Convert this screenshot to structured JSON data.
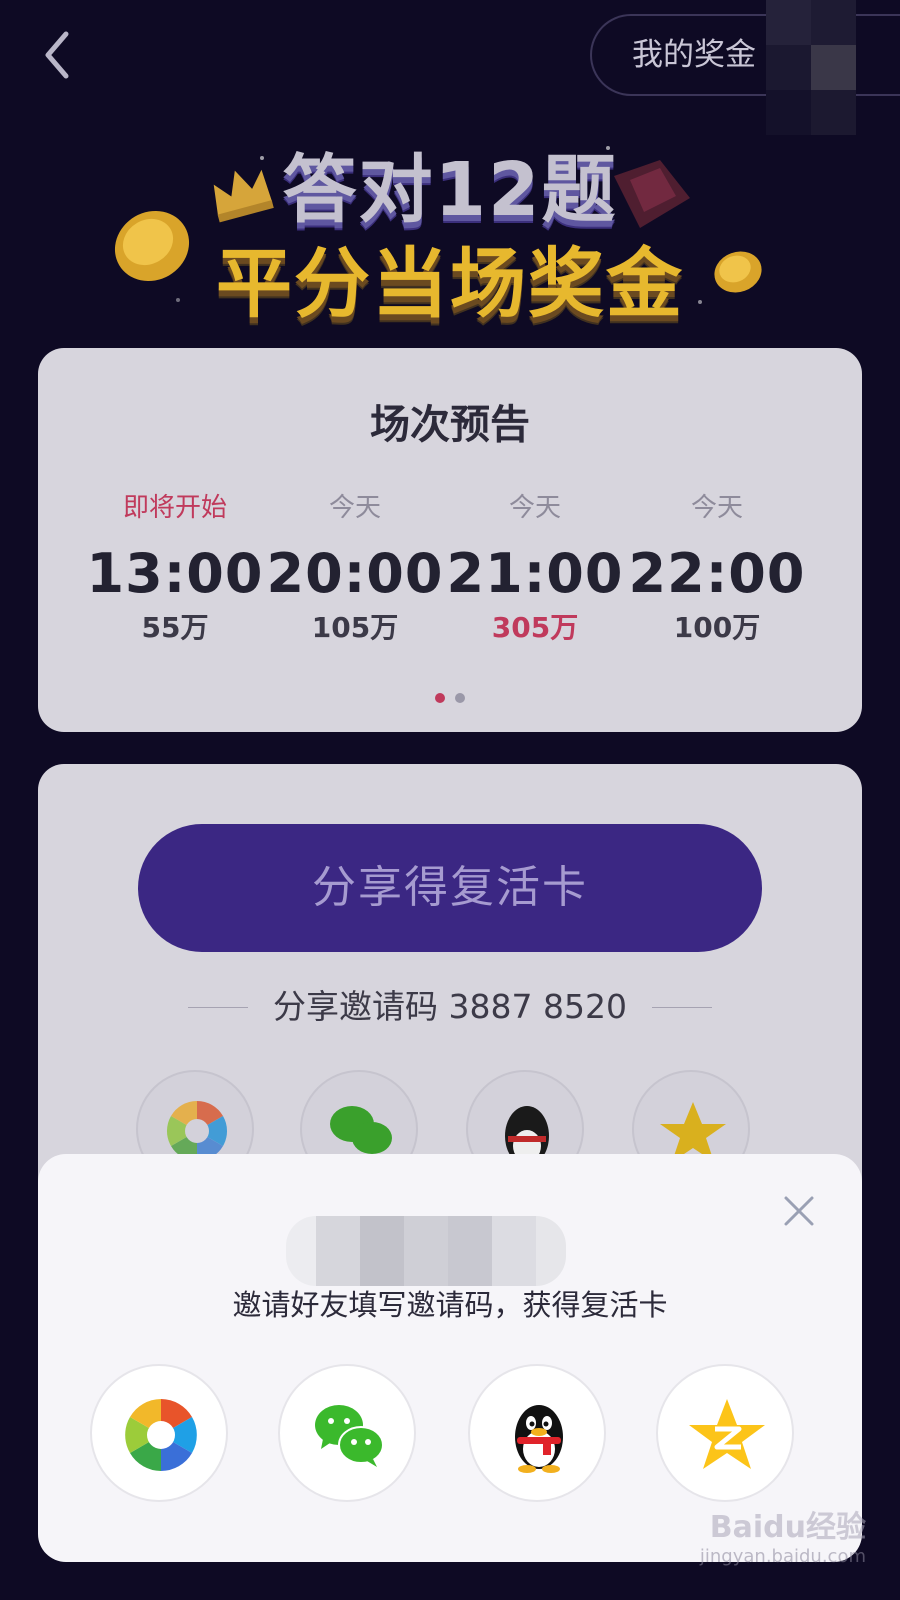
{
  "header": {
    "my_bonus_label": "我的奖金"
  },
  "banner": {
    "line1": "答对12题",
    "line2": "平分当场奖金"
  },
  "schedule": {
    "title": "场次预告",
    "slots": [
      {
        "tag": "即将开始",
        "time": "13:00",
        "prize": "55万"
      },
      {
        "tag": "今天",
        "time": "20:00",
        "prize": "105万"
      },
      {
        "tag": "今天",
        "time": "21:00",
        "prize": "305万"
      },
      {
        "tag": "今天",
        "time": "22:00",
        "prize": "100万"
      }
    ],
    "page_dots": 2,
    "active_dot": 1
  },
  "share": {
    "button_label": "分享得复活卡",
    "invite_code_text": "分享邀请码 3887 8520"
  },
  "modal": {
    "message": "邀请好友填写邀请码，获得复活卡",
    "share_targets": [
      "moments-icon",
      "wechat-icon",
      "qq-icon",
      "qzone-icon"
    ]
  },
  "watermark": {
    "logo": "Baidu经验",
    "url": "jingyan.baidu.com"
  },
  "colors": {
    "background": "#0e0a24",
    "accent_red": "#c03a5c",
    "button_purple": "#3b2783",
    "gold": "#e7b82e"
  }
}
